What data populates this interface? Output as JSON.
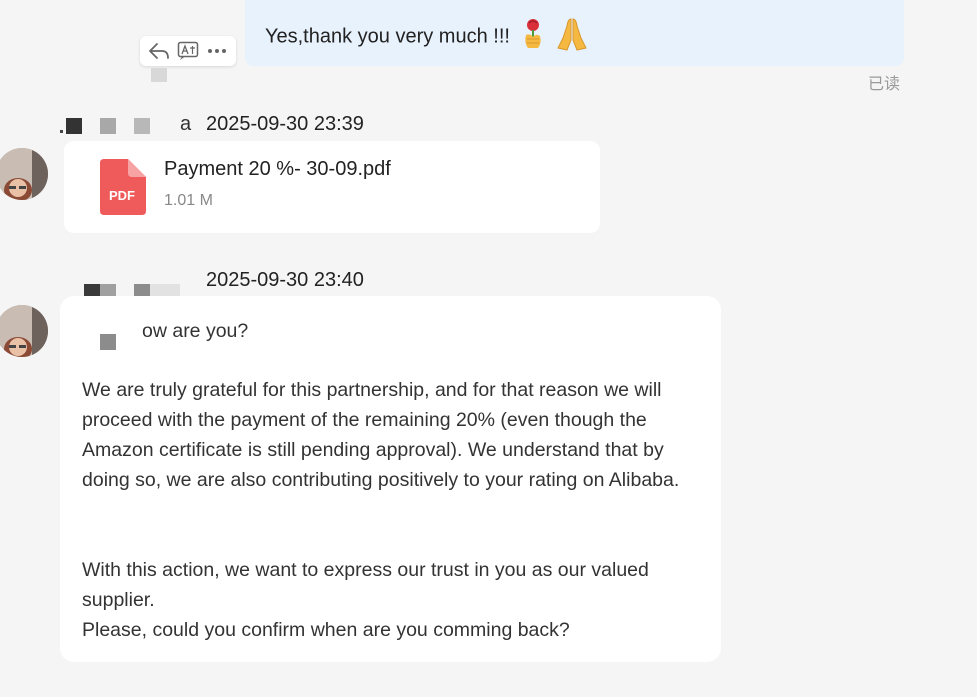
{
  "outgoing_message": {
    "text": "Yes,thank you very much !!!",
    "emojis": [
      "rose-in-hand",
      "folded-hands"
    ],
    "status": "已读"
  },
  "action_bar": {
    "icons": [
      "reply-icon",
      "translate-icon",
      "more-icon"
    ]
  },
  "file_message": {
    "sender_suffix": "a",
    "time": "2025-09-30 23:39",
    "file_type_label": "PDF",
    "file_name": "Payment 20 %- 30-09.pdf",
    "file_size": "1.01 M"
  },
  "text_message": {
    "time": "2025-09-30 23:40",
    "greeting": "ow are you?",
    "paragraph1": "We are truly grateful for this partnership, and for that reason we will proceed with the payment of the remaining 20% (even though the Amazon certificate is still pending approval). We understand that by doing so, we are also contributing positively to your rating on Alibaba.",
    "paragraph2": "With this action, we want to express our trust in you as our valued supplier.",
    "paragraph3": "Please, could you confirm when are you comming back?"
  },
  "colors": {
    "outgoing_bubble": "#e8f2fd",
    "incoming_bubble": "#ffffff",
    "background": "#f5f5f6",
    "pdf_red": "#ef5a5a",
    "read_status": "#9a9a9a"
  }
}
